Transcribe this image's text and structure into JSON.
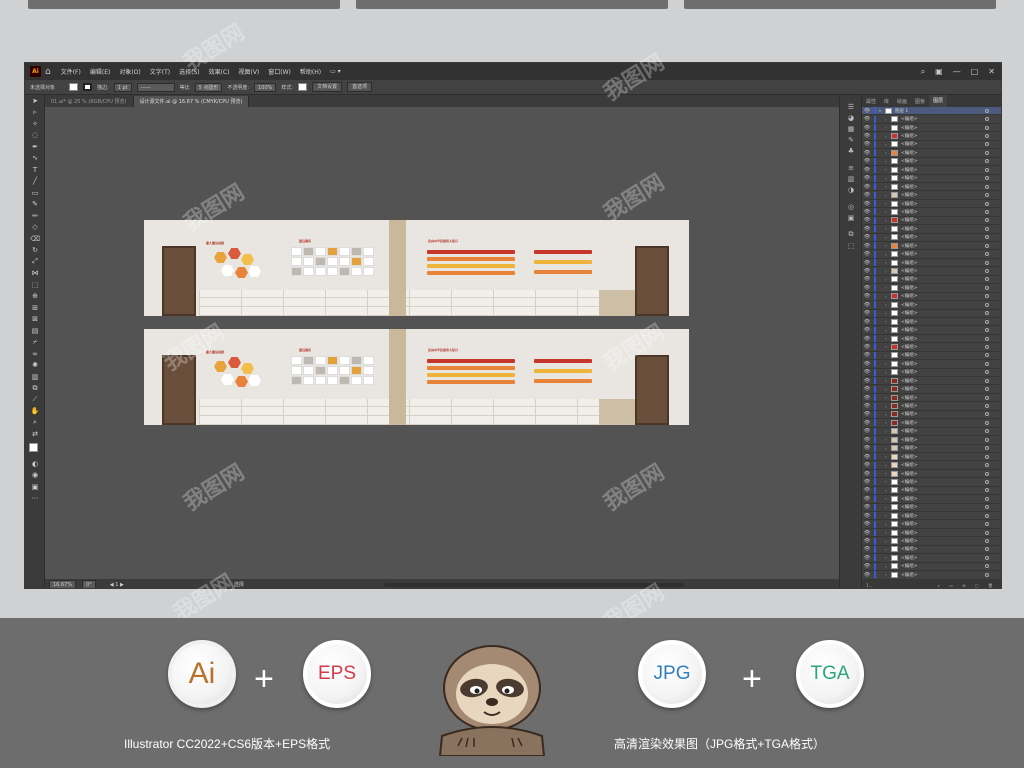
{
  "menu": {
    "app_icon": "Ai",
    "items": [
      "文件(F)",
      "编辑(E)",
      "对象(O)",
      "文字(T)",
      "选择(S)",
      "效果(C)",
      "视图(V)",
      "窗口(W)",
      "帮助(H)"
    ]
  },
  "control_bar": {
    "selection": "未选择对象",
    "stroke_label": "描边:",
    "stroke_value": "1 pt",
    "brush_label": "等比",
    "brush_value": "5 点圆形",
    "opacity_label": "不透明度:",
    "opacity_value": "100%",
    "style_label": "样式:",
    "doc_setup": "文档设置",
    "preferences": "首选项"
  },
  "doc_tabs": [
    "01.ai* @ 25 % (RGB/CPU 预览)",
    "设计源文件.ai @ 16.67 % (CMYK/CPU 预览)"
  ],
  "statusbar": {
    "zoom": "16.67%",
    "angle": "0°",
    "tool": "选择"
  },
  "layers_panel": {
    "tabs": [
      "属性",
      "库",
      "绘画",
      "图板",
      "图层"
    ],
    "layer_name": "图层 1",
    "sublayer": "<编组>",
    "footer": "1..."
  },
  "artwork": {
    "title_a": "重大建设成就",
    "title_b": "望远镜系",
    "title_c": "走向中华民族伟大复兴"
  },
  "bottom": {
    "badges": [
      "Ai",
      "EPS",
      "JPG",
      "TGA"
    ],
    "plus": "+",
    "caption_left": "Illustrator CC2022+CS6版本+EPS格式",
    "caption_right": "高清渲染效果图（JPG格式+TGA格式）"
  }
}
